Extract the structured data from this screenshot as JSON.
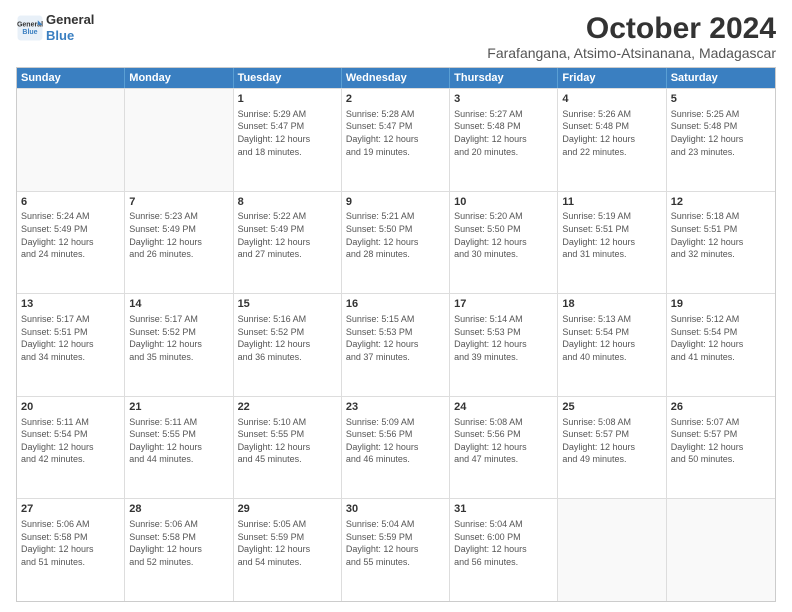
{
  "logo": {
    "line1": "General",
    "line2": "Blue"
  },
  "title": "October 2024",
  "location": "Farafangana, Atsimo-Atsinanana, Madagascar",
  "weekdays": [
    "Sunday",
    "Monday",
    "Tuesday",
    "Wednesday",
    "Thursday",
    "Friday",
    "Saturday"
  ],
  "weeks": [
    [
      {
        "day": "",
        "info": ""
      },
      {
        "day": "",
        "info": ""
      },
      {
        "day": "1",
        "info": "Sunrise: 5:29 AM\nSunset: 5:47 PM\nDaylight: 12 hours\nand 18 minutes."
      },
      {
        "day": "2",
        "info": "Sunrise: 5:28 AM\nSunset: 5:47 PM\nDaylight: 12 hours\nand 19 minutes."
      },
      {
        "day": "3",
        "info": "Sunrise: 5:27 AM\nSunset: 5:48 PM\nDaylight: 12 hours\nand 20 minutes."
      },
      {
        "day": "4",
        "info": "Sunrise: 5:26 AM\nSunset: 5:48 PM\nDaylight: 12 hours\nand 22 minutes."
      },
      {
        "day": "5",
        "info": "Sunrise: 5:25 AM\nSunset: 5:48 PM\nDaylight: 12 hours\nand 23 minutes."
      }
    ],
    [
      {
        "day": "6",
        "info": "Sunrise: 5:24 AM\nSunset: 5:49 PM\nDaylight: 12 hours\nand 24 minutes."
      },
      {
        "day": "7",
        "info": "Sunrise: 5:23 AM\nSunset: 5:49 PM\nDaylight: 12 hours\nand 26 minutes."
      },
      {
        "day": "8",
        "info": "Sunrise: 5:22 AM\nSunset: 5:49 PM\nDaylight: 12 hours\nand 27 minutes."
      },
      {
        "day": "9",
        "info": "Sunrise: 5:21 AM\nSunset: 5:50 PM\nDaylight: 12 hours\nand 28 minutes."
      },
      {
        "day": "10",
        "info": "Sunrise: 5:20 AM\nSunset: 5:50 PM\nDaylight: 12 hours\nand 30 minutes."
      },
      {
        "day": "11",
        "info": "Sunrise: 5:19 AM\nSunset: 5:51 PM\nDaylight: 12 hours\nand 31 minutes."
      },
      {
        "day": "12",
        "info": "Sunrise: 5:18 AM\nSunset: 5:51 PM\nDaylight: 12 hours\nand 32 minutes."
      }
    ],
    [
      {
        "day": "13",
        "info": "Sunrise: 5:17 AM\nSunset: 5:51 PM\nDaylight: 12 hours\nand 34 minutes."
      },
      {
        "day": "14",
        "info": "Sunrise: 5:17 AM\nSunset: 5:52 PM\nDaylight: 12 hours\nand 35 minutes."
      },
      {
        "day": "15",
        "info": "Sunrise: 5:16 AM\nSunset: 5:52 PM\nDaylight: 12 hours\nand 36 minutes."
      },
      {
        "day": "16",
        "info": "Sunrise: 5:15 AM\nSunset: 5:53 PM\nDaylight: 12 hours\nand 37 minutes."
      },
      {
        "day": "17",
        "info": "Sunrise: 5:14 AM\nSunset: 5:53 PM\nDaylight: 12 hours\nand 39 minutes."
      },
      {
        "day": "18",
        "info": "Sunrise: 5:13 AM\nSunset: 5:54 PM\nDaylight: 12 hours\nand 40 minutes."
      },
      {
        "day": "19",
        "info": "Sunrise: 5:12 AM\nSunset: 5:54 PM\nDaylight: 12 hours\nand 41 minutes."
      }
    ],
    [
      {
        "day": "20",
        "info": "Sunrise: 5:11 AM\nSunset: 5:54 PM\nDaylight: 12 hours\nand 42 minutes."
      },
      {
        "day": "21",
        "info": "Sunrise: 5:11 AM\nSunset: 5:55 PM\nDaylight: 12 hours\nand 44 minutes."
      },
      {
        "day": "22",
        "info": "Sunrise: 5:10 AM\nSunset: 5:55 PM\nDaylight: 12 hours\nand 45 minutes."
      },
      {
        "day": "23",
        "info": "Sunrise: 5:09 AM\nSunset: 5:56 PM\nDaylight: 12 hours\nand 46 minutes."
      },
      {
        "day": "24",
        "info": "Sunrise: 5:08 AM\nSunset: 5:56 PM\nDaylight: 12 hours\nand 47 minutes."
      },
      {
        "day": "25",
        "info": "Sunrise: 5:08 AM\nSunset: 5:57 PM\nDaylight: 12 hours\nand 49 minutes."
      },
      {
        "day": "26",
        "info": "Sunrise: 5:07 AM\nSunset: 5:57 PM\nDaylight: 12 hours\nand 50 minutes."
      }
    ],
    [
      {
        "day": "27",
        "info": "Sunrise: 5:06 AM\nSunset: 5:58 PM\nDaylight: 12 hours\nand 51 minutes."
      },
      {
        "day": "28",
        "info": "Sunrise: 5:06 AM\nSunset: 5:58 PM\nDaylight: 12 hours\nand 52 minutes."
      },
      {
        "day": "29",
        "info": "Sunrise: 5:05 AM\nSunset: 5:59 PM\nDaylight: 12 hours\nand 54 minutes."
      },
      {
        "day": "30",
        "info": "Sunrise: 5:04 AM\nSunset: 5:59 PM\nDaylight: 12 hours\nand 55 minutes."
      },
      {
        "day": "31",
        "info": "Sunrise: 5:04 AM\nSunset: 6:00 PM\nDaylight: 12 hours\nand 56 minutes."
      },
      {
        "day": "",
        "info": ""
      },
      {
        "day": "",
        "info": ""
      }
    ]
  ]
}
